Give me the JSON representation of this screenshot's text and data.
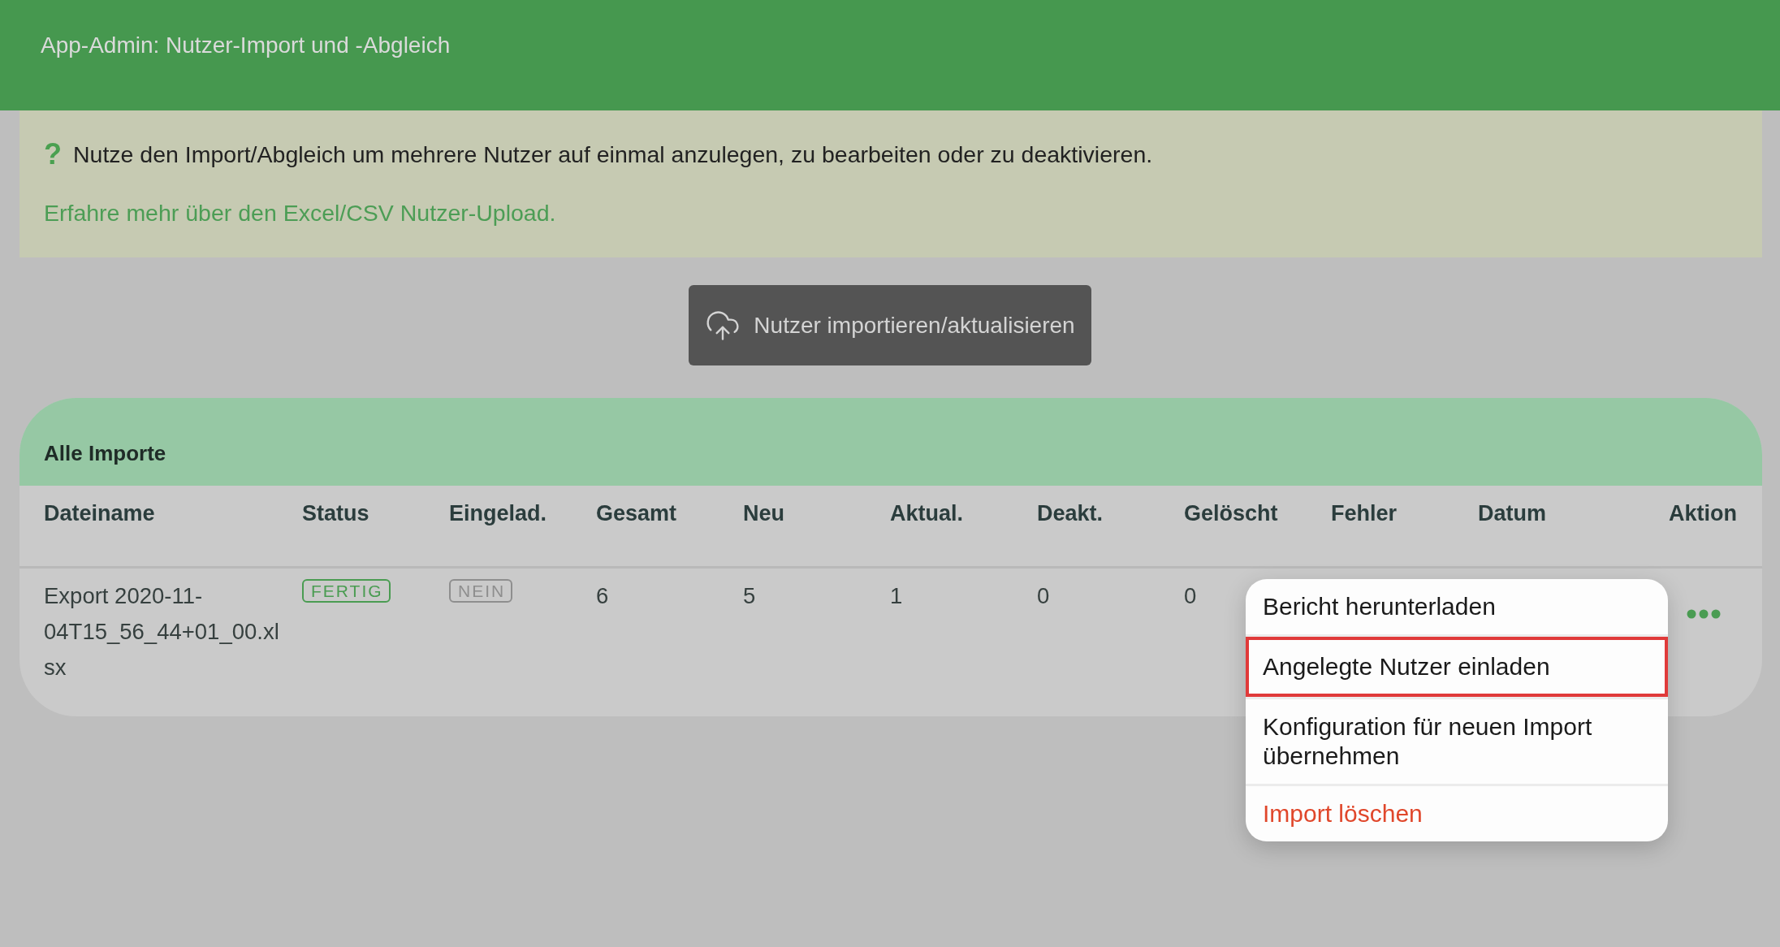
{
  "header": {
    "title": "App-Admin: Nutzer-Import und -Abgleich"
  },
  "info": {
    "icon": "?",
    "text": "Nutze den Import/Abgleich um mehrere Nutzer auf einmal anzulegen, zu bearbeiten oder zu deaktivieren.",
    "link": "Erfahre mehr über den Excel/CSV Nutzer-Upload."
  },
  "import_button": {
    "label": "Nutzer importieren/aktualisieren"
  },
  "imports": {
    "title": "Alle Importe",
    "columns": [
      "Dateiname",
      "Status",
      "Eingelad.",
      "Gesamt",
      "Neu",
      "Aktual.",
      "Deakt.",
      "Gelöscht",
      "Fehler",
      "Datum",
      "Aktion"
    ],
    "rows": [
      {
        "cells": [
          {
            "kind": "text",
            "text": "Export 2020-11-04T15_56_44+01_00.xlsx"
          },
          {
            "kind": "badge",
            "color": "#4a9c52",
            "text": "FERTIG"
          },
          {
            "kind": "badge",
            "color": "#8e8e8e",
            "text": "NEIN"
          },
          {
            "kind": "text",
            "text": "6"
          },
          {
            "kind": "text",
            "text": "5"
          },
          {
            "kind": "text",
            "text": "1"
          },
          {
            "kind": "text",
            "text": "0"
          },
          {
            "kind": "text",
            "text": "0"
          }
        ]
      }
    ]
  },
  "action_menu": {
    "items": [
      {
        "label": "Bericht herunterladen",
        "kind": "normal",
        "highlighted": false
      },
      {
        "label": "Angelegte Nutzer einladen",
        "kind": "normal",
        "highlighted": true
      },
      {
        "label": "Konfiguration für neuen Import übernehmen",
        "kind": "normal",
        "highlighted": false
      },
      {
        "label": "Import löschen",
        "kind": "danger",
        "highlighted": false
      }
    ]
  }
}
